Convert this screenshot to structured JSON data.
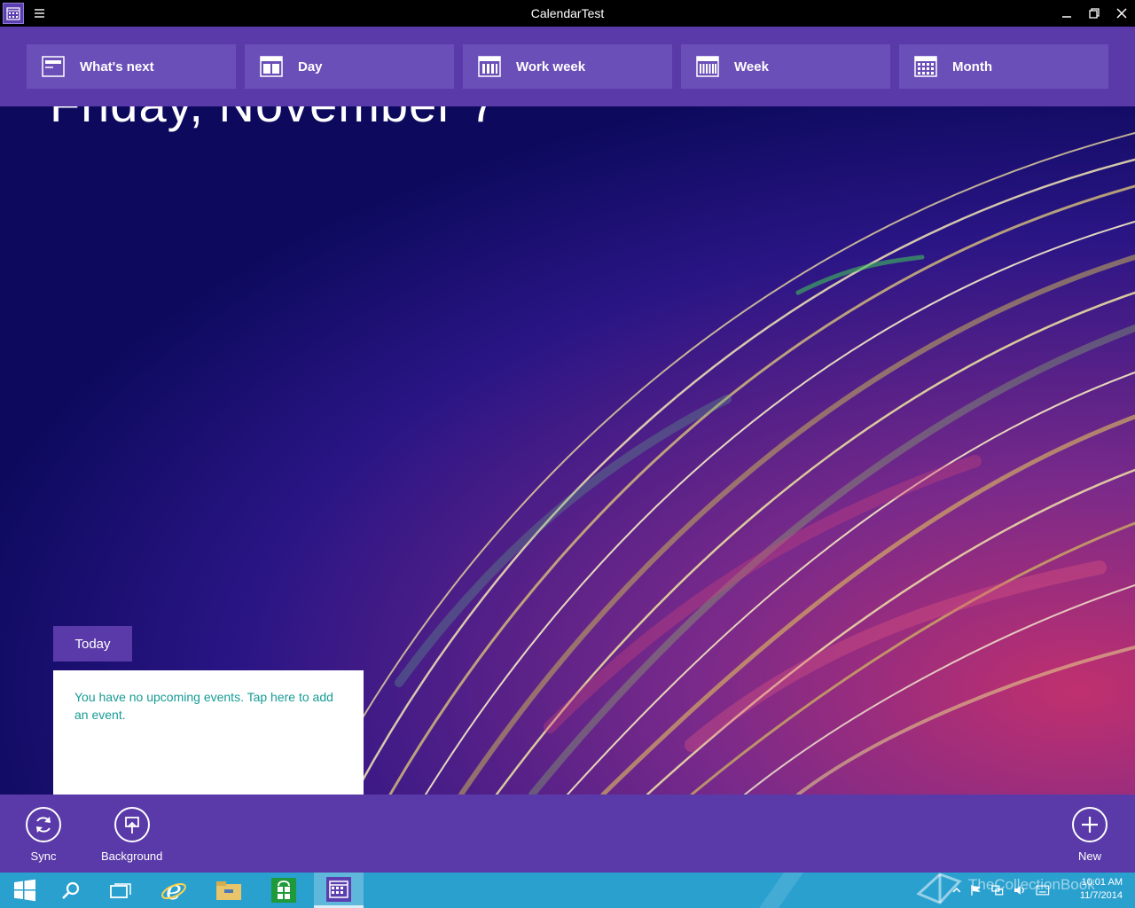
{
  "window": {
    "title": "CalendarTest"
  },
  "nav": {
    "items": [
      {
        "label": "What's next",
        "icon": "whats-next-icon"
      },
      {
        "label": "Day",
        "icon": "day-view-icon"
      },
      {
        "label": "Work week",
        "icon": "work-week-icon"
      },
      {
        "label": "Week",
        "icon": "week-view-icon"
      },
      {
        "label": "Month",
        "icon": "month-view-icon"
      }
    ]
  },
  "main": {
    "date_heading": "Friday, November 7",
    "today_label": "Today",
    "no_events_message": "You have no upcoming events. Tap here to add an event."
  },
  "appbar": {
    "sync_label": "Sync",
    "background_label": "Background",
    "new_label": "New"
  },
  "taskbar": {
    "time": "10:01 AM",
    "date": "11/7/2014",
    "watermark": "TheCollectionBook"
  },
  "colors": {
    "accent": "#5a3aa8",
    "nav_button": "#6b4fb8",
    "link_text": "#169b95",
    "taskbar": "#2aa0cf",
    "titlebar": "#000000"
  }
}
